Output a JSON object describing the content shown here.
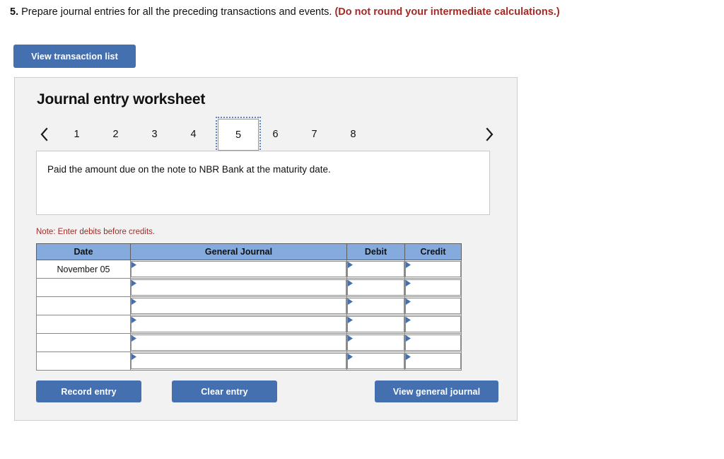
{
  "question": {
    "number": "5.",
    "text": "Prepare journal entries for all the preceding transactions and events.",
    "note": "(Do not round your intermediate calculations.)"
  },
  "toolbar": {
    "view_transaction_list_label": "View transaction list"
  },
  "worksheet": {
    "title": "Journal entry worksheet",
    "prev_arrow_icon": "chevron-left-icon",
    "next_arrow_icon": "chevron-right-icon",
    "tabs": [
      {
        "label": "1",
        "selected": false
      },
      {
        "label": "2",
        "selected": false
      },
      {
        "label": "3",
        "selected": false
      },
      {
        "label": "4",
        "selected": false
      },
      {
        "label": "5",
        "selected": true
      },
      {
        "label": "6",
        "selected": false
      },
      {
        "label": "7",
        "selected": false
      },
      {
        "label": "8",
        "selected": false
      }
    ],
    "description": "Paid the amount due on the note to NBR Bank at the maturity date.",
    "note": "Note: Enter debits before credits."
  },
  "table": {
    "headers": [
      "Date",
      "General Journal",
      "Debit",
      "Credit"
    ],
    "rows": [
      {
        "date": "November 05",
        "journal": "",
        "debit": "",
        "credit": ""
      },
      {
        "date": "",
        "journal": "",
        "debit": "",
        "credit": ""
      },
      {
        "date": "",
        "journal": "",
        "debit": "",
        "credit": ""
      },
      {
        "date": "",
        "journal": "",
        "debit": "",
        "credit": ""
      },
      {
        "date": "",
        "journal": "",
        "debit": "",
        "credit": ""
      },
      {
        "date": "",
        "journal": "",
        "debit": "",
        "credit": ""
      }
    ]
  },
  "actions": {
    "record_entry_label": "Record entry",
    "clear_entry_label": "Clear entry",
    "view_general_journal_label": "View general journal"
  },
  "colors": {
    "button_blue": "#4570B0",
    "table_header_blue": "#85ABDE",
    "note_red": "#A32B26",
    "panel_bg": "#F2F2F2",
    "input_border_blue": "#6E90C4"
  }
}
